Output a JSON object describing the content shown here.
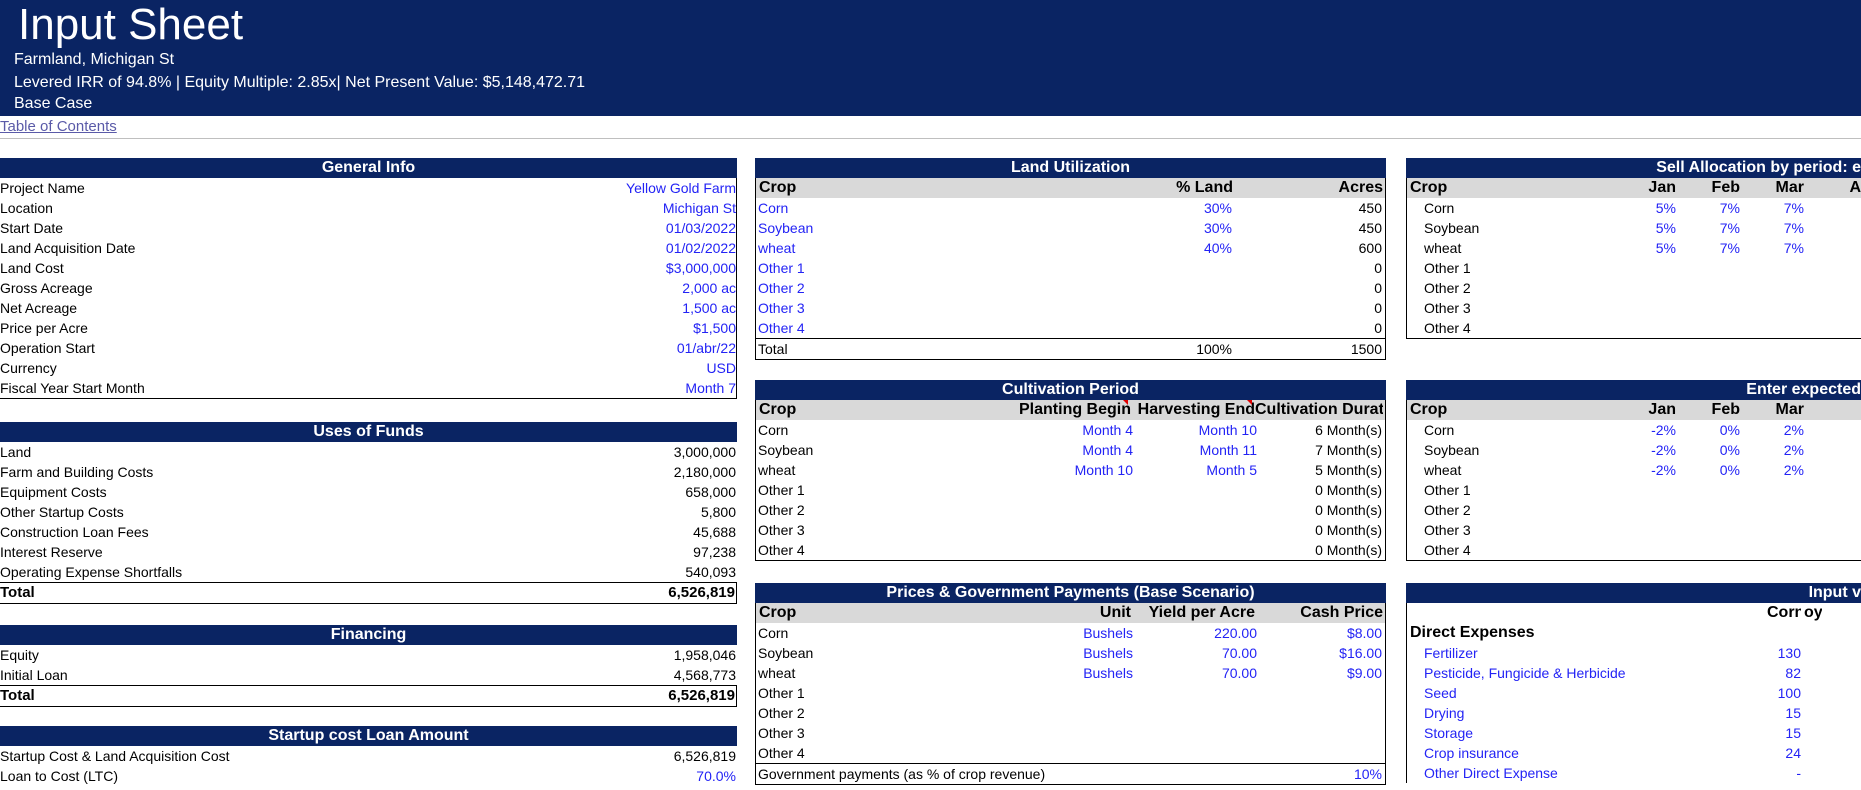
{
  "header": {
    "title": "Input Sheet",
    "subtitle": "Farmland, Michigan St",
    "metrics": "Levered IRR of 94.8% | Equity Multiple: 2.85x| Net Present Value: $5,148,472.71",
    "scenario": "Base Case"
  },
  "toc": "Table of Contents",
  "general": {
    "title": "General Info",
    "rows": [
      {
        "label": "Project Name",
        "value": "Yellow Gold Farm"
      },
      {
        "label": "Location",
        "value": "Michigan St"
      },
      {
        "label": "Start Date",
        "value": "01/03/2022"
      },
      {
        "label": "Land Acquisition Date",
        "value": "01/02/2022"
      },
      {
        "label": "Land Cost",
        "value": "$3,000,000"
      },
      {
        "label": "Gross Acreage",
        "value": "2,000 ac"
      },
      {
        "label": "Net Acreage",
        "value": "1,500 ac"
      },
      {
        "label": "Price per Acre",
        "value": "$1,500"
      },
      {
        "label": "Operation Start",
        "value": "01/abr/22"
      },
      {
        "label": "Currency",
        "value": "USD"
      },
      {
        "label": "Fiscal Year Start Month",
        "value": "Month 7"
      }
    ]
  },
  "uses": {
    "title": "Uses of Funds",
    "rows": [
      {
        "label": "Land",
        "value": "3,000,000"
      },
      {
        "label": "Farm and Building Costs",
        "value": "2,180,000"
      },
      {
        "label": "Equipment Costs",
        "value": "658,000"
      },
      {
        "label": "Other Startup Costs",
        "value": "5,800"
      },
      {
        "label": "Construction Loan Fees",
        "value": "45,688"
      },
      {
        "label": "Interest Reserve",
        "value": "97,238"
      },
      {
        "label": "Operating Expense Shortfalls",
        "value": "540,093"
      }
    ],
    "total_label": "Total",
    "total_value": "6,526,819"
  },
  "financing": {
    "title": "Financing",
    "rows": [
      {
        "label": "Equity",
        "value": "1,958,046"
      },
      {
        "label": "Initial Loan",
        "value": "4,568,773"
      }
    ],
    "total_label": "Total",
    "total_value": "6,526,819"
  },
  "startup": {
    "title": "Startup cost Loan Amount",
    "rows": [
      {
        "label": "Startup Cost & Land Acquisition Cost",
        "value": "6,526,819"
      },
      {
        "label": "Loan to Cost (LTC)",
        "value": "70.0%"
      }
    ]
  },
  "land": {
    "title": "Land Utilization",
    "headers": [
      "Crop",
      "% Land",
      "Acres"
    ],
    "rows": [
      {
        "crop": "Corn",
        "pct": "30%",
        "acres": "450"
      },
      {
        "crop": "Soybean",
        "pct": "30%",
        "acres": "450"
      },
      {
        "crop": "wheat",
        "pct": "40%",
        "acres": "600"
      },
      {
        "crop": "Other 1",
        "pct": "",
        "acres": "0"
      },
      {
        "crop": "Other 2",
        "pct": "",
        "acres": "0"
      },
      {
        "crop": "Other 3",
        "pct": "",
        "acres": "0"
      },
      {
        "crop": "Other 4",
        "pct": "",
        "acres": "0"
      }
    ],
    "total_label": "Total",
    "total_pct": "100%",
    "total_acres": "1500"
  },
  "cultivation": {
    "title": "Cultivation Period",
    "headers": [
      "Crop",
      "Planting Begin",
      "Harvesting End",
      "Cultivation Duration"
    ],
    "rows": [
      {
        "crop": "Corn",
        "begin": "Month 4",
        "end": "Month 10",
        "dur": "6 Month(s)"
      },
      {
        "crop": "Soybean",
        "begin": "Month 4",
        "end": "Month 11",
        "dur": "7 Month(s)"
      },
      {
        "crop": "wheat",
        "begin": "Month 10",
        "end": "Month 5",
        "dur": "5 Month(s)"
      },
      {
        "crop": "Other 1",
        "begin": "",
        "end": "",
        "dur": "0 Month(s)"
      },
      {
        "crop": "Other 2",
        "begin": "",
        "end": "",
        "dur": "0 Month(s)"
      },
      {
        "crop": "Other 3",
        "begin": "",
        "end": "",
        "dur": "0 Month(s)"
      },
      {
        "crop": "Other 4",
        "begin": "",
        "end": "",
        "dur": "0 Month(s)"
      }
    ]
  },
  "prices": {
    "title": "Prices & Government Payments (Base Scenario)",
    "headers": [
      "Crop",
      "Unit",
      "Yield per Acre",
      "Cash Price"
    ],
    "rows": [
      {
        "crop": "Corn",
        "unit": "Bushels",
        "yield": "220.00",
        "price": "$8.00"
      },
      {
        "crop": "Soybean",
        "unit": "Bushels",
        "yield": "70.00",
        "price": "$16.00"
      },
      {
        "crop": "wheat",
        "unit": "Bushels",
        "yield": "70.00",
        "price": "$9.00"
      },
      {
        "crop": "Other 1",
        "unit": "",
        "yield": "",
        "price": ""
      },
      {
        "crop": "Other 2",
        "unit": "",
        "yield": "",
        "price": ""
      },
      {
        "crop": "Other 3",
        "unit": "",
        "yield": "",
        "price": ""
      },
      {
        "crop": "Other 4",
        "unit": "",
        "yield": "",
        "price": ""
      }
    ],
    "gov_label": "Government payments (as % of crop revenue)",
    "gov_value": "10%"
  },
  "sell": {
    "title": "Sell Allocation by period: e",
    "headers": [
      "Crop",
      "Jan",
      "Feb",
      "Mar",
      "A"
    ],
    "rows": [
      {
        "crop": "Corn",
        "jan": "5%",
        "feb": "7%",
        "mar": "7%"
      },
      {
        "crop": "Soybean",
        "jan": "5%",
        "feb": "7%",
        "mar": "7%"
      },
      {
        "crop": "wheat",
        "jan": "5%",
        "feb": "7%",
        "mar": "7%"
      },
      {
        "crop": "Other 1",
        "jan": "",
        "feb": "",
        "mar": ""
      },
      {
        "crop": "Other 2",
        "jan": "",
        "feb": "",
        "mar": ""
      },
      {
        "crop": "Other 3",
        "jan": "",
        "feb": "",
        "mar": ""
      },
      {
        "crop": "Other 4",
        "jan": "",
        "feb": "",
        "mar": ""
      }
    ]
  },
  "expected": {
    "title": "Enter expected",
    "headers": [
      "Crop",
      "Jan",
      "Feb",
      "Mar"
    ],
    "rows": [
      {
        "crop": "Corn",
        "jan": "-2%",
        "feb": "0%",
        "mar": "2%"
      },
      {
        "crop": "Soybean",
        "jan": "-2%",
        "feb": "0%",
        "mar": "2%"
      },
      {
        "crop": "wheat",
        "jan": "-2%",
        "feb": "0%",
        "mar": "2%"
      },
      {
        "crop": "Other 1",
        "jan": "",
        "feb": "",
        "mar": ""
      },
      {
        "crop": "Other 2",
        "jan": "",
        "feb": "",
        "mar": ""
      },
      {
        "crop": "Other 3",
        "jan": "",
        "feb": "",
        "mar": ""
      },
      {
        "crop": "Other 4",
        "jan": "",
        "feb": "",
        "mar": ""
      }
    ]
  },
  "input": {
    "title": "Input v",
    "col_header": "Corn",
    "col_header2": "oy",
    "section": "Direct Expenses",
    "rows": [
      {
        "label": "Fertilizer",
        "value": "130"
      },
      {
        "label": "Pesticide, Fungicide & Herbicide",
        "value": "82"
      },
      {
        "label": "Seed",
        "value": "100"
      },
      {
        "label": "Drying",
        "value": "15"
      },
      {
        "label": "Storage",
        "value": "15"
      },
      {
        "label": "Crop insurance",
        "value": "24"
      },
      {
        "label": "Other Direct Expense",
        "value": "-"
      }
    ]
  }
}
